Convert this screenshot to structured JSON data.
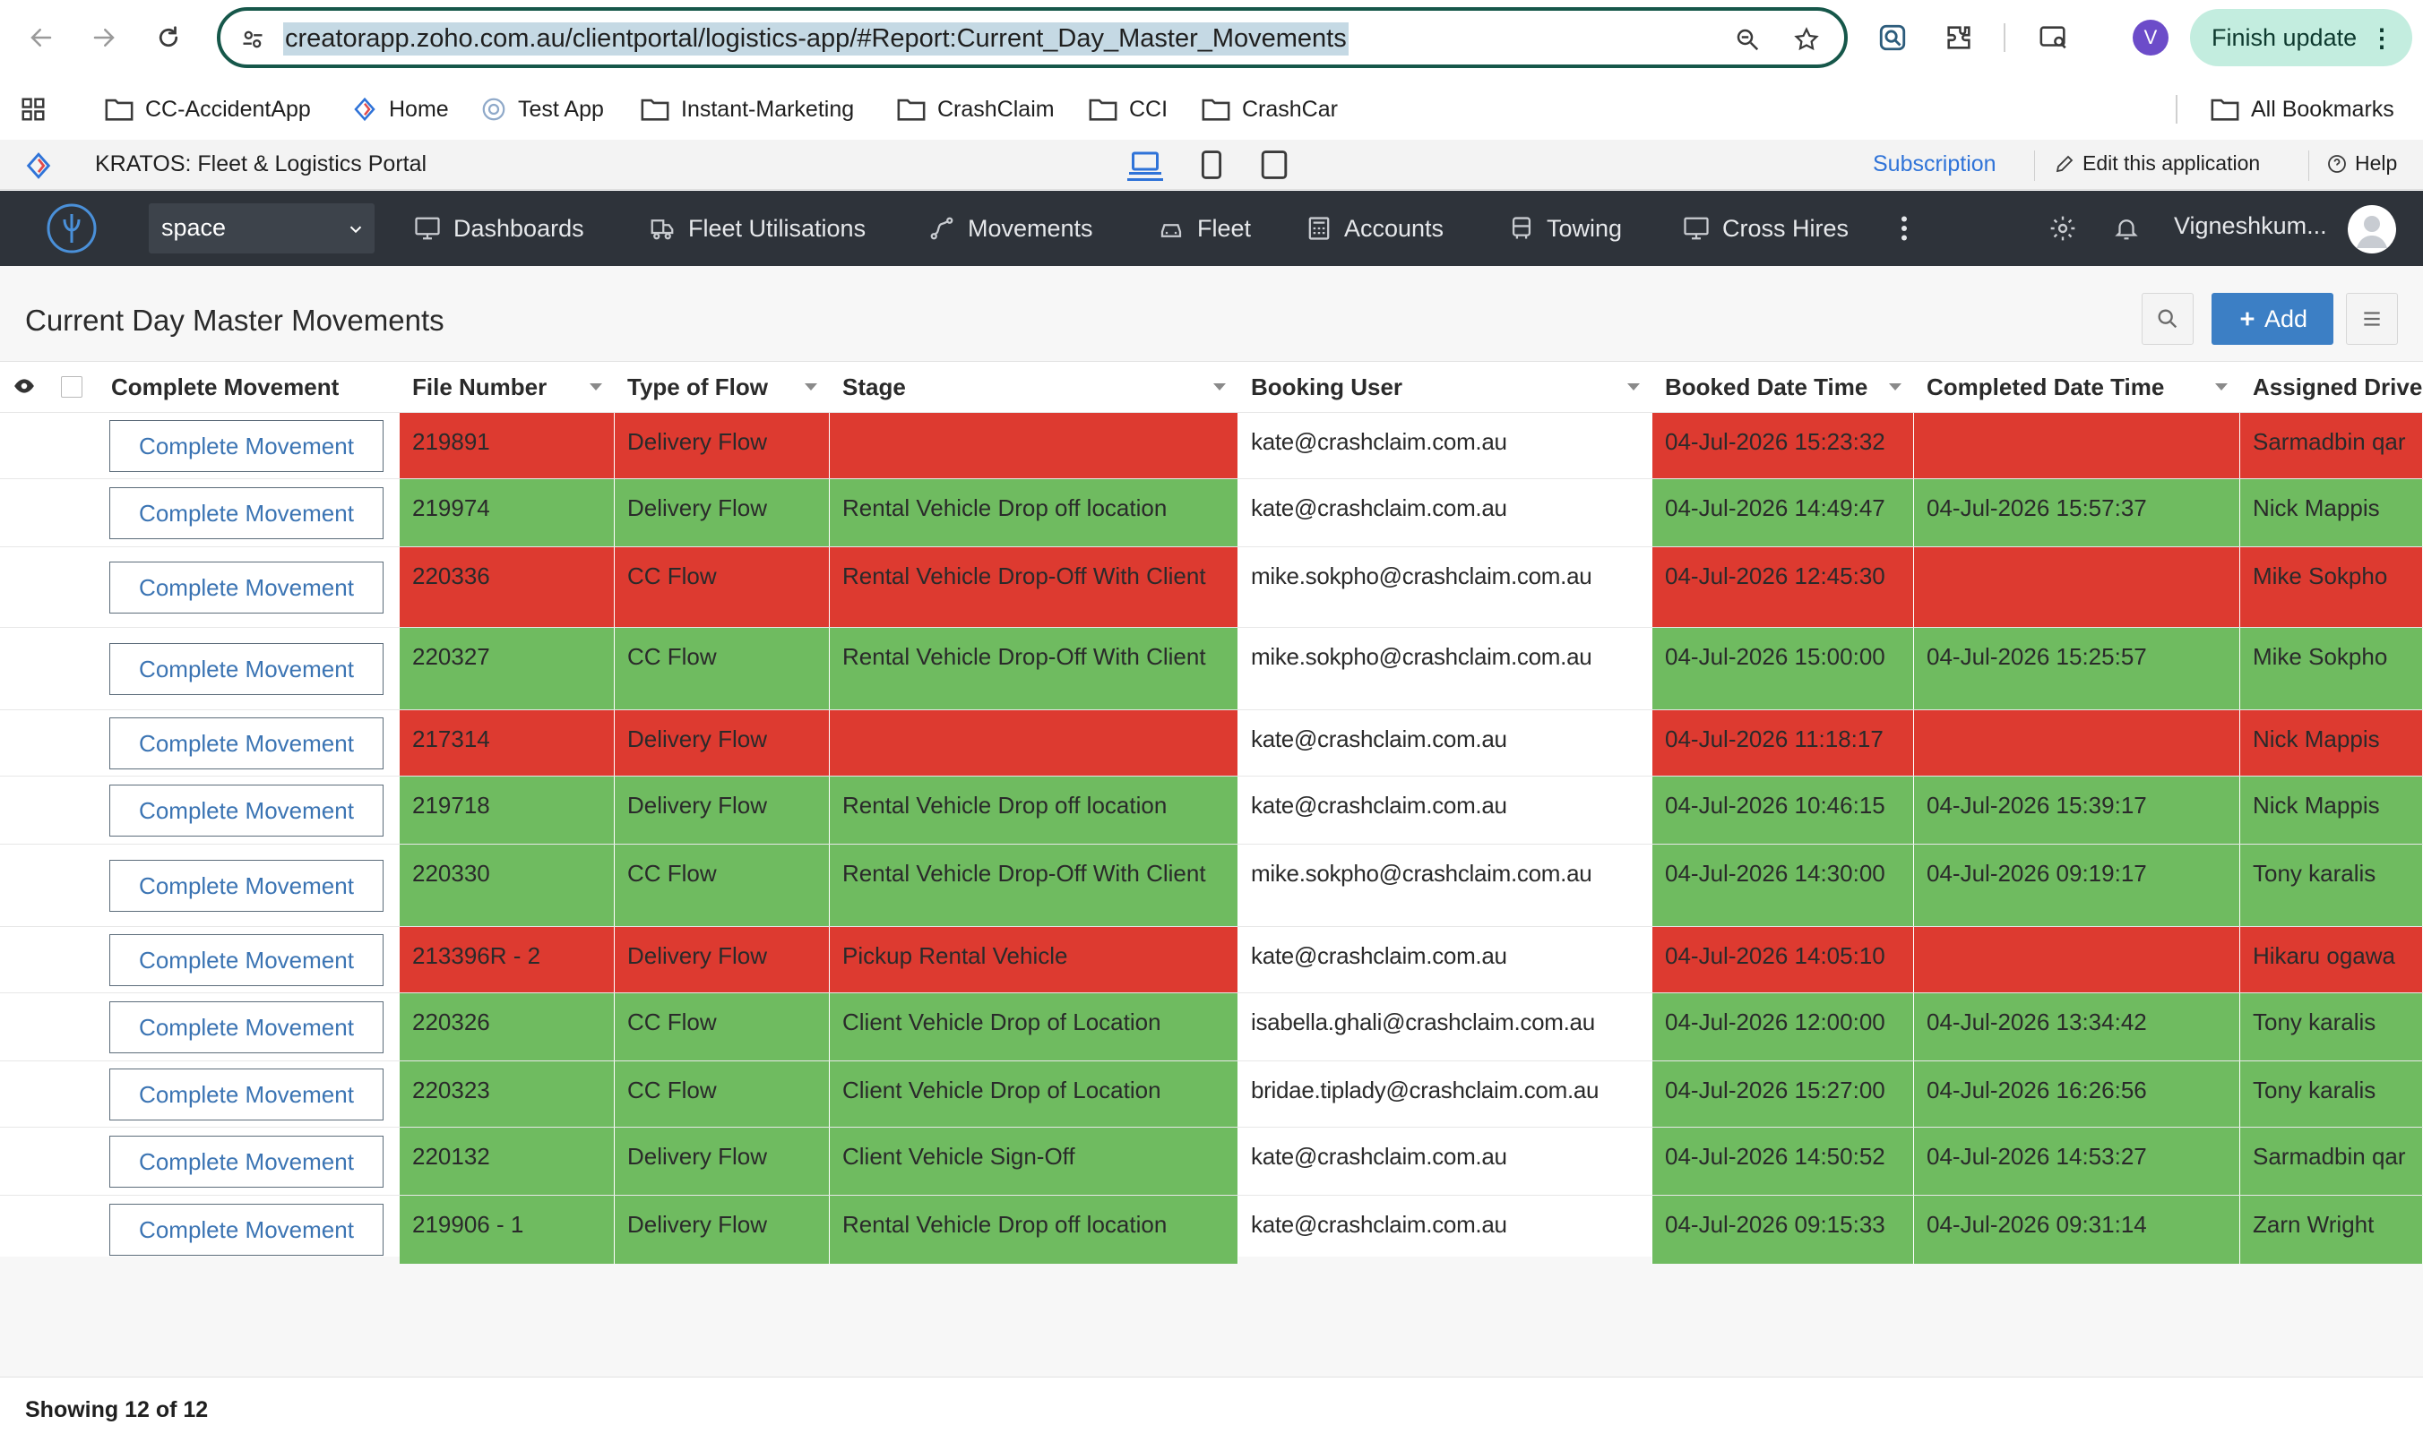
{
  "browser": {
    "url": "creatorapp.zoho.com.au/clientportal/logistics-app/#Report:Current_Day_Master_Movements",
    "profile_initial": "V",
    "finish_update_label": "Finish update"
  },
  "bookmarks": [
    {
      "label": "CC-AccidentApp",
      "icon": "folder-icon"
    },
    {
      "label": "Home",
      "icon": "zoho-icon"
    },
    {
      "label": "Test App",
      "icon": "globe-icon"
    },
    {
      "label": "Instant-Marketing",
      "icon": "folder-icon"
    },
    {
      "label": "CrashClaim",
      "icon": "folder-icon"
    },
    {
      "label": "CCI",
      "icon": "folder-icon"
    },
    {
      "label": "CrashCar",
      "icon": "folder-icon"
    }
  ],
  "all_bookmarks_label": "All Bookmarks",
  "app_bar": {
    "title": "KRATOS: Fleet & Logistics Portal",
    "subscription": "Subscription",
    "edit_label": "Edit this application",
    "help_label": "Help"
  },
  "nav": {
    "space_value": "space",
    "items": [
      {
        "label": "Dashboards",
        "icon": "monitor-icon"
      },
      {
        "label": "Fleet Utilisations",
        "icon": "truck-icon"
      },
      {
        "label": "Movements",
        "icon": "route-icon"
      },
      {
        "label": "Fleet",
        "icon": "car-icon"
      },
      {
        "label": "Accounts",
        "icon": "calculator-icon"
      },
      {
        "label": "Towing",
        "icon": "bus-icon"
      },
      {
        "label": "Cross Hires",
        "icon": "monitor-icon"
      }
    ],
    "user_name": "Vigneshkum..."
  },
  "report": {
    "title": "Current Day Master Movements",
    "add_label": "Add",
    "footer": "Showing 12 of 12",
    "columns": [
      "Complete Movement",
      "File Number",
      "Type of Flow",
      "Stage",
      "Booking User",
      "Booked Date Time",
      "Completed Date Time",
      "Assigned Drive"
    ],
    "button_label": "Complete Movement",
    "colors": {
      "red": "#dd3a30",
      "green": "#6fbb60"
    },
    "rows": [
      {
        "status": "red",
        "file": "219891",
        "flow": "Delivery Flow",
        "stage": "",
        "user": "kate@crashclaim.com.au",
        "booked": "04-Jul-2026 15:23:32",
        "completed": "",
        "driver": "Sarmadbin qar"
      },
      {
        "status": "green",
        "file": "219974",
        "flow": "Delivery Flow",
        "stage": "Rental Vehicle Drop off location",
        "user": "kate@crashclaim.com.au",
        "booked": "04-Jul-2026 14:49:47",
        "completed": "04-Jul-2026 15:57:37",
        "driver": "Nick Mappis"
      },
      {
        "status": "red",
        "file": "220336",
        "flow": "CC Flow",
        "stage": "Rental Vehicle Drop-Off With Client",
        "user": "mike.sokpho@crashclaim.com.au",
        "booked": "04-Jul-2026 12:45:30",
        "completed": "",
        "driver": "Mike Sokpho"
      },
      {
        "status": "green",
        "file": "220327",
        "flow": "CC Flow",
        "stage": "Rental Vehicle Drop-Off With Client",
        "user": "mike.sokpho@crashclaim.com.au",
        "booked": "04-Jul-2026 15:00:00",
        "completed": "04-Jul-2026 15:25:57",
        "driver": "Mike Sokpho"
      },
      {
        "status": "red",
        "file": "217314",
        "flow": "Delivery Flow",
        "stage": "",
        "user": "kate@crashclaim.com.au",
        "booked": "04-Jul-2026 11:18:17",
        "completed": "",
        "driver": "Nick Mappis"
      },
      {
        "status": "green",
        "file": "219718",
        "flow": "Delivery Flow",
        "stage": "Rental Vehicle Drop off location",
        "user": "kate@crashclaim.com.au",
        "booked": "04-Jul-2026 10:46:15",
        "completed": "04-Jul-2026 15:39:17",
        "driver": "Nick Mappis"
      },
      {
        "status": "green",
        "file": "220330",
        "flow": "CC Flow",
        "stage": "Rental Vehicle Drop-Off With Client",
        "user": "mike.sokpho@crashclaim.com.au",
        "booked": "04-Jul-2026 14:30:00",
        "completed": "04-Jul-2026 09:19:17",
        "driver": "Tony karalis"
      },
      {
        "status": "red",
        "file": "213396R - 2",
        "flow": "Delivery Flow",
        "stage": "Pickup Rental Vehicle",
        "user": "kate@crashclaim.com.au",
        "booked": "04-Jul-2026 14:05:10",
        "completed": "",
        "driver": "Hikaru ogawa"
      },
      {
        "status": "green",
        "file": "220326",
        "flow": "CC Flow",
        "stage": "Client Vehicle Drop of Location",
        "user": "isabella.ghali@crashclaim.com.au",
        "booked": "04-Jul-2026 12:00:00",
        "completed": "04-Jul-2026 13:34:42",
        "driver": "Tony karalis"
      },
      {
        "status": "green",
        "file": "220323",
        "flow": "CC Flow",
        "stage": "Client Vehicle Drop of Location",
        "user": "bridae.tiplady@crashclaim.com.au",
        "booked": "04-Jul-2026 15:27:00",
        "completed": "04-Jul-2026 16:26:56",
        "driver": "Tony karalis"
      },
      {
        "status": "green",
        "file": "220132",
        "flow": "Delivery Flow",
        "stage": "Client Vehicle Sign-Off",
        "user": "kate@crashclaim.com.au",
        "booked": "04-Jul-2026 14:50:52",
        "completed": "04-Jul-2026 14:53:27",
        "driver": "Sarmadbin qar"
      },
      {
        "status": "green",
        "file": "219906 - 1",
        "flow": "Delivery Flow",
        "stage": "Rental Vehicle Drop off location",
        "user": "kate@crashclaim.com.au",
        "booked": "04-Jul-2026 09:15:33",
        "completed": "04-Jul-2026 09:31:14",
        "driver": "Zarn Wright"
      }
    ]
  }
}
